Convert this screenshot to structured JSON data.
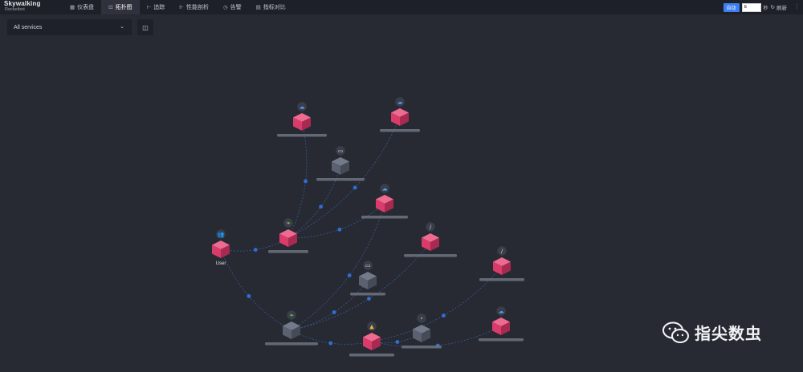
{
  "app": {
    "logo_main": "Skywalking",
    "logo_sub": "Rocketbot"
  },
  "nav": [
    {
      "label": "仪表盘",
      "icon": "dashboard-icon",
      "glyph": "▦",
      "active": false
    },
    {
      "label": "拓扑图",
      "icon": "topology-icon",
      "glyph": "⊡",
      "active": true
    },
    {
      "label": "追踪",
      "icon": "trace-icon",
      "glyph": "⊢",
      "active": false
    },
    {
      "label": "性能剖析",
      "icon": "profile-icon",
      "glyph": "⊩",
      "active": false
    },
    {
      "label": "告警",
      "icon": "alarm-icon",
      "glyph": "◷",
      "active": false
    },
    {
      "label": "指标对比",
      "icon": "compare-icon",
      "glyph": "▤",
      "active": false
    }
  ],
  "toolbar": {
    "auto_label": "自动",
    "interval_value": "6",
    "interval_unit": "秒",
    "refresh_label": "刷新"
  },
  "filter": {
    "service_select": "All services"
  },
  "colors": {
    "node_service": "#d93c6a",
    "node_remote": "#5b6170",
    "edge": "#3a5f9c",
    "edge_dot": "#2f6fd6"
  },
  "topology": {
    "nodes": [
      {
        "id": "user",
        "kind": "service",
        "icon": "user-icon",
        "label": "User"
      },
      {
        "id": "n_top1",
        "kind": "service",
        "icon": "cloud-icon",
        "label": ""
      },
      {
        "id": "n_top2",
        "kind": "service",
        "icon": "cloud-icon",
        "label": ""
      },
      {
        "id": "n_db1",
        "kind": "remote",
        "icon": "database-icon",
        "label": ""
      },
      {
        "id": "n_mid1",
        "kind": "service",
        "icon": "cloud-icon",
        "label": ""
      },
      {
        "id": "n_gw1",
        "kind": "service",
        "icon": "spring-icon",
        "label": ""
      },
      {
        "id": "n_r1",
        "kind": "service",
        "icon": "feather-icon",
        "label": ""
      },
      {
        "id": "n_db2",
        "kind": "remote",
        "icon": "database-icon",
        "label": ""
      },
      {
        "id": "n_r2",
        "kind": "service",
        "icon": "feather-icon",
        "label": ""
      },
      {
        "id": "n_gw2",
        "kind": "remote",
        "icon": "spring-icon",
        "label": ""
      },
      {
        "id": "n_rocket",
        "kind": "service",
        "icon": "rocket-icon",
        "label": ""
      },
      {
        "id": "n_rem3",
        "kind": "remote",
        "icon": "unknown-icon",
        "label": ""
      },
      {
        "id": "n_r3",
        "kind": "service",
        "icon": "cloud-icon",
        "label": ""
      }
    ],
    "edges": [
      [
        "user",
        "n_gw1"
      ],
      [
        "user",
        "n_gw2"
      ],
      [
        "n_gw1",
        "n_top1"
      ],
      [
        "n_gw1",
        "n_top2"
      ],
      [
        "n_gw1",
        "n_db1"
      ],
      [
        "n_gw1",
        "n_mid1"
      ],
      [
        "n_gw2",
        "n_r1"
      ],
      [
        "n_gw2",
        "n_db2"
      ],
      [
        "n_gw2",
        "n_rocket"
      ],
      [
        "n_gw2",
        "n_mid1"
      ],
      [
        "n_rocket",
        "n_rem3"
      ],
      [
        "n_rocket",
        "n_r2"
      ],
      [
        "n_rocket",
        "n_r3"
      ]
    ]
  },
  "watermark": {
    "text": "指尖数虫",
    "icon": "wechat-icon"
  }
}
